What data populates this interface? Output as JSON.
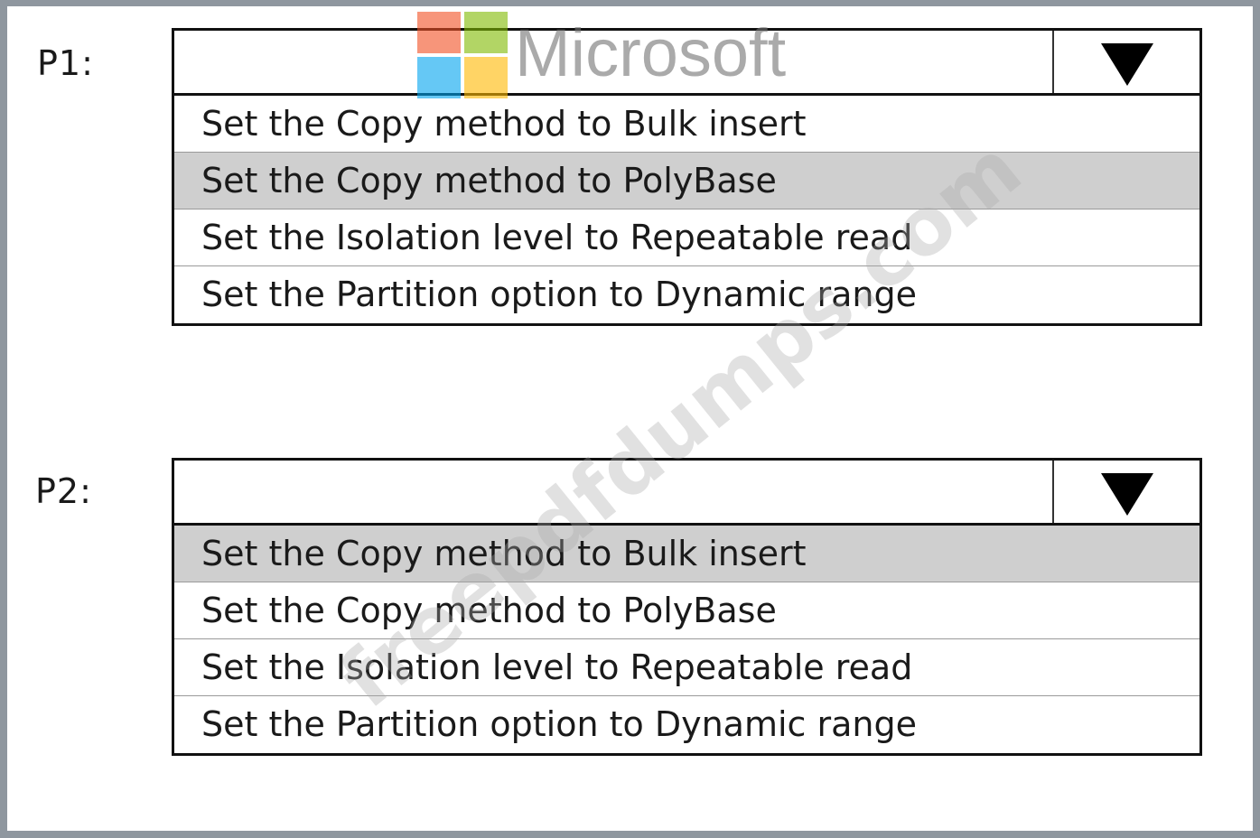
{
  "p1": {
    "label": "P1:",
    "selected_value": "",
    "options": [
      "Set the Copy method to Bulk insert",
      "Set the Copy method to PolyBase",
      "Set the Isolation level to Repeatable read",
      "Set the Partition option to Dynamic range"
    ],
    "highlighted_option": "Set the Copy method to PolyBase"
  },
  "p2": {
    "label": "P2:",
    "selected_value": "",
    "options": [
      "Set the Copy method to Bulk insert",
      "Set the Copy method to PolyBase",
      "Set the Isolation level to Repeatable read",
      "Set the Partition option to Dynamic range"
    ],
    "highlighted_option": "Set the Copy method to Bulk insert"
  },
  "logo": {
    "text": "Microsoft",
    "colors": [
      "#f25022",
      "#7fba00",
      "#00a4ef",
      "#ffb900"
    ]
  },
  "watermark": {
    "text": "freepdfdumps.com"
  },
  "icons": {
    "dropdown_toggle": "triangle-down-icon"
  },
  "colors": {
    "frame_border": "#8f979f",
    "highlight": "#cfcfcf"
  }
}
